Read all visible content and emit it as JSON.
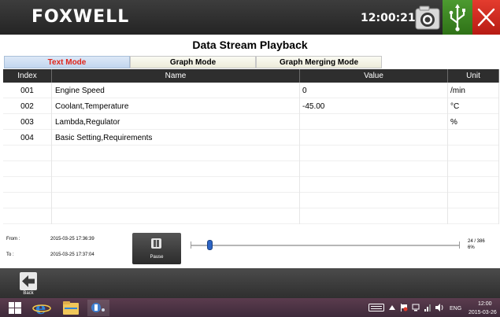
{
  "header": {
    "brand": "FOXWELL",
    "clock": "12:00:21",
    "icons": [
      "camera-icon",
      "usb-icon",
      "close-icon"
    ],
    "colors": {
      "usb_button": "#3b8423",
      "close_button": "#d22a20"
    }
  },
  "page_title": "Data Stream Playback",
  "tabs": [
    {
      "label": "Text Mode",
      "active": true
    },
    {
      "label": "Graph Mode",
      "active": false
    },
    {
      "label": "Graph Merging Mode",
      "active": false
    }
  ],
  "table": {
    "columns": [
      "Index",
      "Name",
      "Value",
      "Unit"
    ],
    "rows": [
      {
        "index": "001",
        "name": "Engine Speed",
        "value": "0",
        "unit": "/min"
      },
      {
        "index": "002",
        "name": "Coolant,Temperature",
        "value": "-45.00",
        "unit": "°C"
      },
      {
        "index": "003",
        "name": "Lambda,Regulator",
        "value": "",
        "unit": "%"
      },
      {
        "index": "004",
        "name": "Basic Setting,Requirements",
        "value": "",
        "unit": ""
      },
      {
        "index": "",
        "name": "",
        "value": "",
        "unit": ""
      },
      {
        "index": "",
        "name": "",
        "value": "",
        "unit": ""
      },
      {
        "index": "",
        "name": "",
        "value": "",
        "unit": ""
      },
      {
        "index": "",
        "name": "",
        "value": "",
        "unit": ""
      },
      {
        "index": "",
        "name": "",
        "value": "",
        "unit": ""
      }
    ]
  },
  "playback": {
    "from_label": "From :",
    "from_time": "2015-03-25 17:36:39",
    "to_label": "To :",
    "to_time": "2015-03-25 17:37:04",
    "pause_label": "Pause",
    "frame_count": "24 / 386",
    "percent": "6%",
    "progress": 0.06
  },
  "bottom": {
    "back_label": "Back"
  },
  "taskbar": {
    "icons": [
      "windows-start-icon",
      "internet-explorer-icon",
      "file-explorer-icon",
      "app-icon"
    ],
    "tray_icons": [
      "keyboard-icon",
      "up-arrow-icon",
      "flag-icon",
      "network-icon",
      "signal-icon",
      "volume-icon"
    ],
    "language": "ENG",
    "time": "12:00",
    "date": "2015-03-26"
  }
}
